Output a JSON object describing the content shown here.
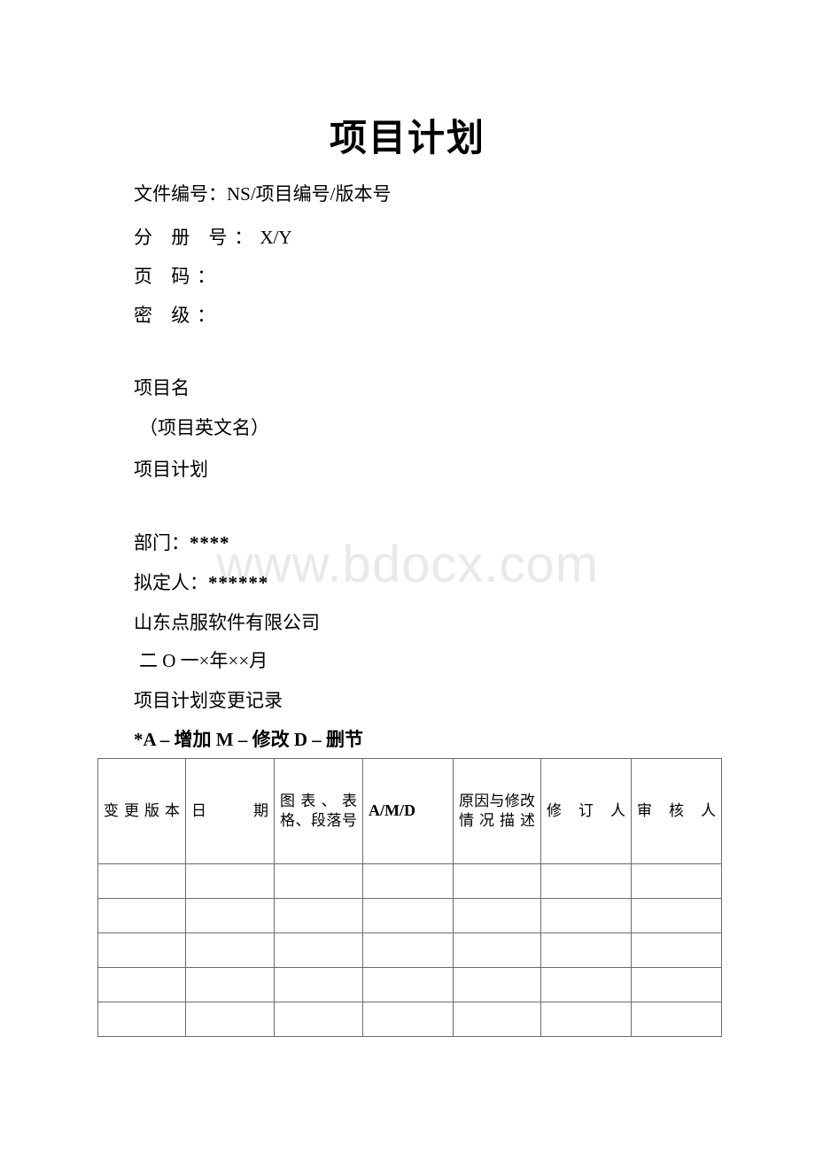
{
  "document": {
    "title": "项目计划",
    "watermark": "www.bdocx.com",
    "header_fields": [
      {
        "label": "文件编号：",
        "value": "NS/项目编号/版本号",
        "spread": false
      },
      {
        "label": "分 册 号：",
        "value": "X/Y",
        "spread": true
      },
      {
        "label": "页 码：",
        "value": "",
        "spread": true
      },
      {
        "label": "密 级：",
        "value": "",
        "spread": true
      }
    ],
    "cover_block": [
      {
        "text": "项目名",
        "indent": false
      },
      {
        "text": "（项目英文名）",
        "indent": true
      },
      {
        "text": "项目计划",
        "indent": false
      }
    ],
    "signature_block": {
      "department_label": "部门：",
      "department_value": "****",
      "author_label": "拟定人：",
      "author_value": "******",
      "company": "山东点服软件有限公司",
      "date": "二 O 一×年××月"
    },
    "section_heading": "项目计划变更记录",
    "legend": "*A – 增加 M – 修改 D – 删节"
  },
  "change_table": {
    "headers": [
      "变更版本",
      "日期",
      "图表、表格、段落号",
      "A/M/D",
      "原因与修改情况描述",
      "修订人",
      "审核人"
    ],
    "rows": [
      [
        "",
        "",
        "",
        "",
        "",
        "",
        ""
      ],
      [
        "",
        "",
        "",
        "",
        "",
        "",
        ""
      ],
      [
        "",
        "",
        "",
        "",
        "",
        "",
        ""
      ],
      [
        "",
        "",
        "",
        "",
        "",
        "",
        ""
      ],
      [
        "",
        "",
        "",
        "",
        "",
        "",
        ""
      ]
    ]
  }
}
